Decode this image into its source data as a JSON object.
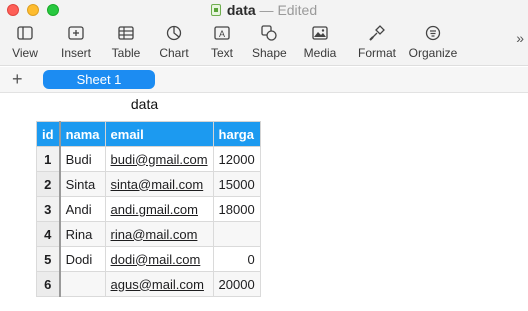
{
  "window": {
    "title": "data",
    "status": "Edited"
  },
  "toolbar": [
    {
      "label": "View",
      "icon": "sidebar-icon"
    },
    {
      "label": "Insert",
      "icon": "insert-icon"
    },
    {
      "label": "Table",
      "icon": "table-icon"
    },
    {
      "label": "Chart",
      "icon": "chart-icon"
    },
    {
      "label": "Text",
      "icon": "text-icon"
    },
    {
      "label": "Shape",
      "icon": "shape-icon"
    },
    {
      "label": "Media",
      "icon": "media-icon"
    },
    {
      "label": "Format",
      "icon": "format-icon"
    },
    {
      "label": "Organize",
      "icon": "organize-icon"
    }
  ],
  "tabs": {
    "add": "+",
    "sheet": "Sheet 1"
  },
  "table": {
    "title": "data",
    "headers": [
      "id",
      "nama",
      "email",
      "harga"
    ],
    "rows": [
      [
        "1",
        "Budi",
        "budi@gmail.com",
        "12000"
      ],
      [
        "2",
        "Sinta",
        "sinta@mail.com",
        "15000"
      ],
      [
        "3",
        "Andi",
        "andi.gmail.com",
        "18000"
      ],
      [
        "4",
        "Rina",
        "rina@mail.com",
        ""
      ],
      [
        "5",
        "Dodi",
        "dodi@mail.com",
        "0"
      ],
      [
        "6",
        "",
        "agus@mail.com",
        "20000"
      ]
    ]
  },
  "colors": {
    "accent": "#1c8cf2",
    "header": "#1c9af0"
  }
}
